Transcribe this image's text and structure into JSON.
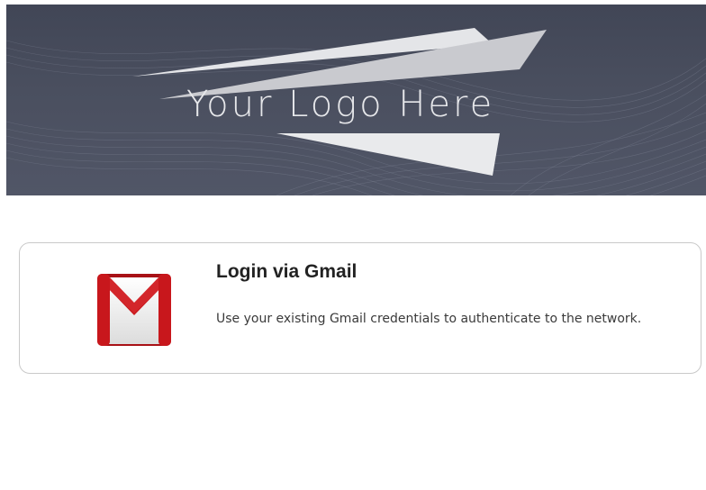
{
  "banner": {
    "logo_text": "Your Logo Here",
    "background_color": "#454a5a"
  },
  "login_option": {
    "icon": "gmail-icon",
    "title": "Login via Gmail",
    "description": "Use your existing Gmail credentials to authenticate to the network.",
    "accent_color": "#c8171c"
  }
}
